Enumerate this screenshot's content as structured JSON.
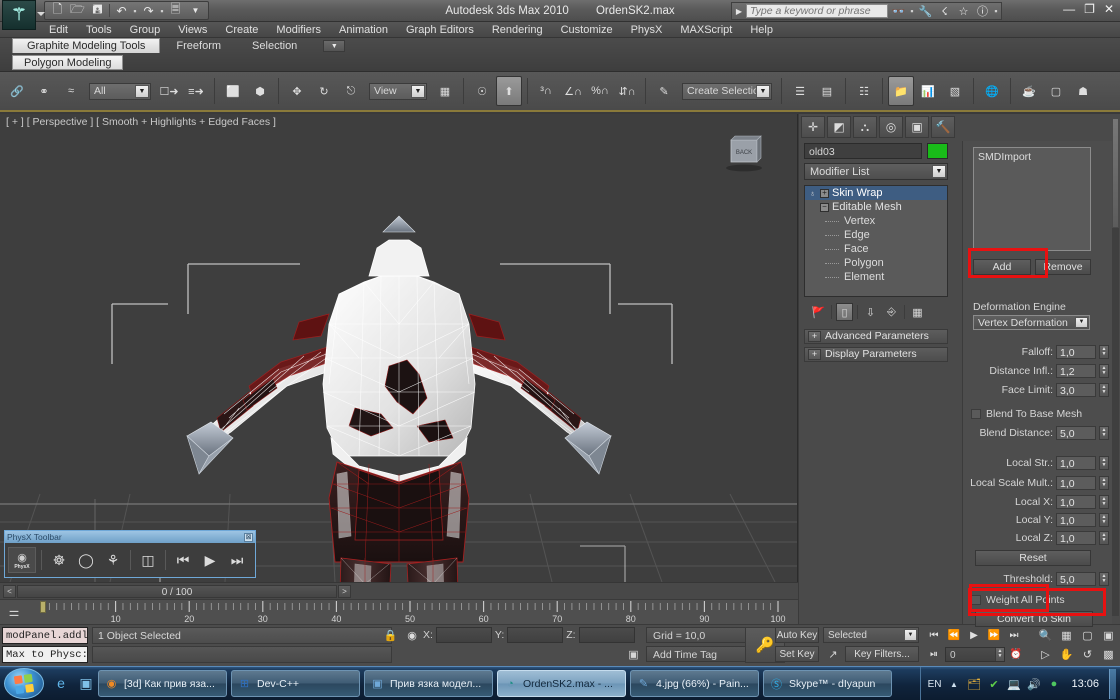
{
  "window": {
    "app_title": "Autodesk 3ds Max  2010",
    "file_name": "OrdenSK2.max",
    "minimize": "—",
    "restore": "❐",
    "close": "✕"
  },
  "quick_access": {
    "new_icon": "new-file-icon",
    "open_icon": "open-folder-icon",
    "save_icon": "save-disk-icon",
    "undo_icon": "undo-arrow-icon",
    "redo_icon": "redo-arrow-icon",
    "setkey_icon": "set-key-icon",
    "more_icon": "chevron-down-icon"
  },
  "search": {
    "placeholder": "Type a keyword or phrase",
    "icons": [
      "binoculars-icon",
      "wrench-icon",
      "satellite-icon",
      "star-icon",
      "help-icon"
    ]
  },
  "menu": {
    "items": [
      "Edit",
      "Tools",
      "Group",
      "Views",
      "Create",
      "Modifiers",
      "Animation",
      "Graph Editors",
      "Rendering",
      "Customize",
      "PhysX",
      "MAXScript",
      "Help"
    ]
  },
  "ribbon": {
    "tabs": [
      {
        "label": "Graphite Modeling Tools",
        "active": true
      },
      {
        "label": "Freeform",
        "active": false
      },
      {
        "label": "Selection",
        "active": false
      }
    ],
    "subtab": "Polygon Modeling",
    "filter_value": "All",
    "view_value": "View",
    "selection_set_value": "Create Selection Se"
  },
  "viewport": {
    "label": "[ + ] [ Perspective ] [ Smooth + Highlights + Edged Faces ]",
    "viewcube_face": "BACK",
    "mesh_wire_color": "#ffffff",
    "mesh_selected_color": "#8f1111",
    "background_color": "#3e3e3e"
  },
  "physx_toolbar": {
    "title": "PhysX Toolbar",
    "close_label": "⊠",
    "logo_label": "PhysX",
    "buttons": [
      "ragdoll-icon",
      "capsule-icon",
      "cloth-icon",
      "particles-icon",
      "rewind-icon",
      "play-icon",
      "step-forward-icon"
    ]
  },
  "time_slider": {
    "prev_label": "<",
    "frame_label": "0 / 100",
    "next_label": ">",
    "ruler_ticks": [
      "10",
      "20",
      "30",
      "40",
      "50",
      "60",
      "70",
      "80",
      "90",
      "100"
    ]
  },
  "status": {
    "maxscript_listener": "modPanel.addl",
    "maxscript_mini": "Max to Physc:",
    "prompt": "1 Object Selected",
    "lock_icon": "lock-icon",
    "coord_labels": [
      "X:",
      "Y:",
      "Z:"
    ],
    "coord_values": [
      "",
      "",
      ""
    ],
    "grid": "Grid = 10,0",
    "add_time_tag": "Add Time Tag",
    "key_icon": "key-icon",
    "auto_key": "Auto Key",
    "set_key": "Set Key",
    "key_mode_value": "Selected",
    "key_filters": "Key Filters...",
    "frame_value": "0",
    "playback_icons": [
      "go-to-start-icon",
      "prev-frame-icon",
      "play-icon",
      "next-frame-icon",
      "go-to-end-icon"
    ],
    "nav_icons": [
      "zoom-icon",
      "zoom-all-icon",
      "zoom-extents-icon",
      "zoom-region-icon",
      "field-of-view-icon",
      "pan-icon",
      "orbit-icon",
      "maximize-viewport-icon"
    ]
  },
  "command_panel": {
    "tabs": [
      {
        "name": "create-tab",
        "glyph": "✛",
        "selected": false
      },
      {
        "name": "modify-tab",
        "glyph": "◩",
        "selected": false
      },
      {
        "name": "hierarchy-tab",
        "glyph": "⛬",
        "selected": false
      },
      {
        "name": "motion-tab",
        "glyph": "◎",
        "selected": false
      },
      {
        "name": "display-tab",
        "glyph": "▣",
        "selected": false
      },
      {
        "name": "utilities-tab",
        "glyph": "🔨",
        "selected": false
      }
    ],
    "object_name": "old03",
    "object_color": "#19bb19",
    "modifier_list_label": "Modifier List",
    "stack": [
      {
        "label": "Skin Wrap",
        "selected": true,
        "level": 0
      },
      {
        "label": "Editable Mesh",
        "selected": false,
        "level": 0
      },
      {
        "label": "Vertex",
        "selected": false,
        "level": 1
      },
      {
        "label": "Edge",
        "selected": false,
        "level": 1
      },
      {
        "label": "Face",
        "selected": false,
        "level": 1
      },
      {
        "label": "Polygon",
        "selected": false,
        "level": 1
      },
      {
        "label": "Element",
        "selected": false,
        "level": 1
      }
    ],
    "stack_buttons": [
      "pin-stack-icon",
      "show-end-result-icon",
      "make-unique-icon",
      "remove-modifier-icon",
      "configure-sets-icon"
    ],
    "rollouts": [
      {
        "label": "Advanced Parameters",
        "expand": "+"
      },
      {
        "label": "Display Parameters",
        "expand": "+"
      }
    ],
    "skin_wrap": {
      "mesh_list": [
        "SMDImport"
      ],
      "add_label": "Add",
      "remove_label": "Remove",
      "deformation_engine_label": "Deformation Engine",
      "deformation_engine_value": "Vertex Deformation",
      "params": [
        {
          "label": "Falloff:",
          "value": "1,0"
        },
        {
          "label": "Distance Infl.:",
          "value": "1,2"
        },
        {
          "label": "Face Limit:",
          "value": "3,0"
        }
      ],
      "blend_to_base_mesh_label": "Blend To Base Mesh",
      "blend_to_base_mesh_checked": false,
      "blend_distance_label": "Blend Distance:",
      "blend_distance_value": "5,0",
      "local_params": [
        {
          "label": "Local Str.:",
          "value": "1,0"
        },
        {
          "label": "Local Scale Mult.:",
          "value": "1,0"
        },
        {
          "label": "Local X:",
          "value": "1,0"
        },
        {
          "label": "Local Y:",
          "value": "1,0"
        },
        {
          "label": "Local Z:",
          "value": "1,0"
        }
      ],
      "reset_label": "Reset",
      "threshold_label": "Threshold:",
      "threshold_value": "5,0",
      "weight_all_points_label": "Weight All Points",
      "weight_all_points_checked": false,
      "convert_to_skin_label": "Convert To Skin",
      "highlight_color": "#e81111"
    }
  },
  "taskbar": {
    "start_label": "start-orb-icon",
    "quick_launch": [
      "internet-explorer-icon",
      "show-desktop-icon"
    ],
    "items": [
      {
        "label": "[3d] Как прив яза...",
        "icon": "firefox-icon",
        "active": false
      },
      {
        "label": "Dev-C++",
        "icon": "devcpp-icon",
        "active": false
      },
      {
        "label": "Прив язка модел...",
        "icon": "window-icon",
        "active": false
      },
      {
        "label": "OrdenSK2.max - ...",
        "icon": "3dsmax-icon",
        "active": true
      },
      {
        "label": "4.jpg (66%) - Pain...",
        "icon": "paint-icon",
        "active": false
      },
      {
        "label": "Skype™ - dIyapun",
        "icon": "skype-icon",
        "active": false
      }
    ],
    "tray_lang": "EN",
    "tray_icons": [
      "show-hidden-icon",
      "updates-icon",
      "shield-icon",
      "network-icon",
      "volume-icon",
      "antivirus-icon"
    ],
    "clock": "13:06"
  }
}
